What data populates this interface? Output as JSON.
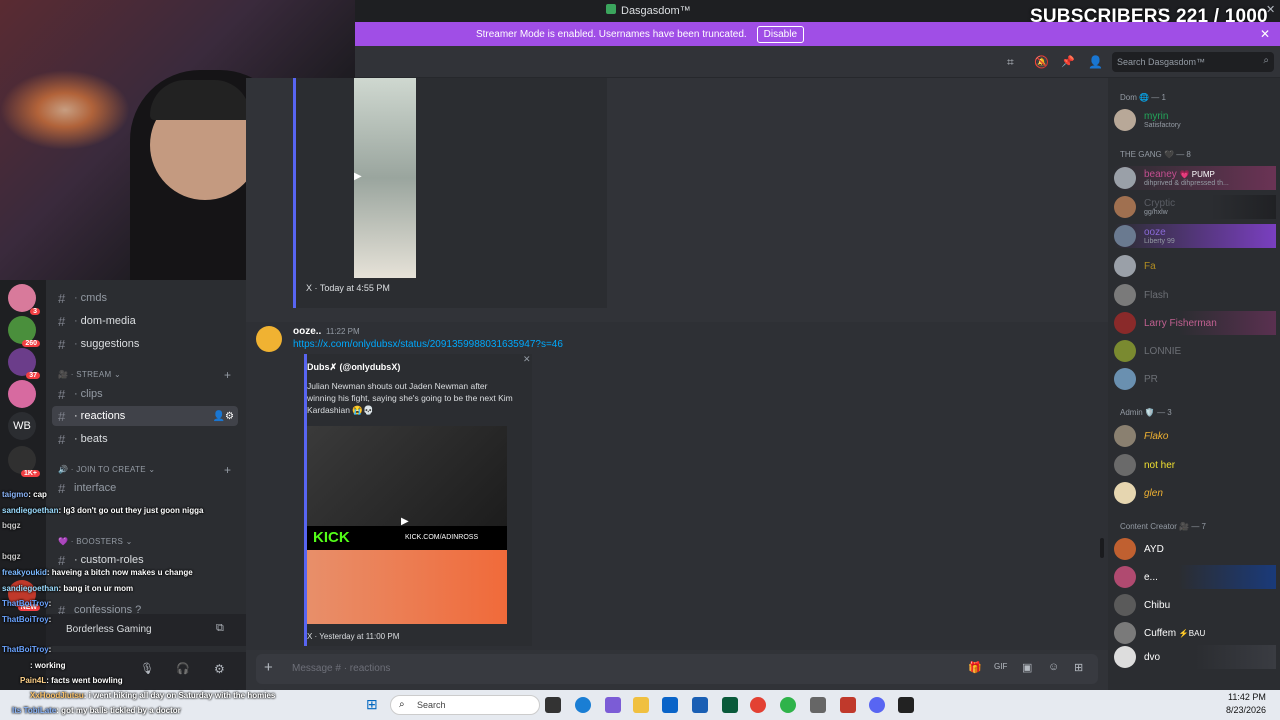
{
  "window": {
    "title": "Dasgasdom™"
  },
  "overlay": {
    "subscribers": "SUBSCRIBERS 221 / 1000"
  },
  "streamer_banner": {
    "text": "Streamer Mode is enabled. Usernames have been truncated.",
    "button": "Disable"
  },
  "header": {
    "search_placeholder": "Search Dasgasdom™"
  },
  "servers": {
    "badges": [
      "3",
      "260",
      "37",
      "WB",
      "1K+",
      "NEW"
    ]
  },
  "channels": {
    "items": [
      {
        "name": "cmds"
      },
      {
        "name": "dom-media"
      },
      {
        "name": "suggestions"
      }
    ],
    "category_stream": "STREAM",
    "stream_items": [
      {
        "name": "clips"
      },
      {
        "name": "reactions"
      },
      {
        "name": "beats"
      }
    ],
    "category_join": "JOIN TO CREATE",
    "join_item": "interface",
    "category_boosters": "BOOSTERS",
    "booster_item": "custom-roles",
    "confessions": "confessions ?",
    "voice_server": "Borderless Gaming"
  },
  "stream_chat": [
    {
      "user": "taigmo",
      "text": ": cap"
    },
    {
      "user": "sandiegoethan",
      "text": ": lg3 don't go out they just goon nigga"
    },
    {
      "user": "bqgz",
      "text": ""
    },
    {
      "user": "bqgz",
      "text": ""
    },
    {
      "user": "freakyoukid",
      "text": ": haveing a bitch now makes u change"
    },
    {
      "user": "sandiegoethan",
      "text": ": bang it on ur mom"
    },
    {
      "user": "ThatBoiTroy",
      "text": ":"
    },
    {
      "user": "ThatBoiTroy",
      "text": ":"
    },
    {
      "user": "ThatBoiTroy",
      "text": ":"
    },
    {
      "user": "",
      "text": ": working"
    },
    {
      "user": "Pain4L",
      "text": ": facts went bowling"
    },
    {
      "user": "XxHoodJiutsu",
      "text": ": i went hiking all day on Saturday with the homies"
    },
    {
      "user": "Its TobiLate",
      "text": ": got my balls tickled by a doctor"
    }
  ],
  "messages": [
    {
      "embed_footer": "X · Today at 4:55 PM"
    },
    {
      "author": "ooze..",
      "time": "11:22 PM",
      "link": "https://x.com/onlydubsx/status/2091359988031635947?s=46",
      "embed_author": "Dubs✗ (@onlydubsX)",
      "embed_text": "Julian Newman shouts out Jaden Newman after winning his fight, saying she's going to be the next Kim Kardashian 😭💀",
      "image_text": "KICK",
      "image_url_text": "KICK.COM/ADINROSS",
      "embed_footer": "X · Yesterday at 11:00 PM"
    }
  ],
  "composer": {
    "placeholder": "Message # · reactions"
  },
  "members": {
    "group_dom": "Dom 🌐 — 1",
    "dom": [
      {
        "name": "myrin",
        "status": "Satisfactory",
        "color": "#23a55a"
      }
    ],
    "group_gang": "THE GANG 🖤 — 8",
    "gang": [
      {
        "name": "beaney",
        "status": "dihprived & dihpressed th...",
        "tag": "💗 PUMP",
        "color": "#c24e8f"
      },
      {
        "name": "Cryptic",
        "status": "gg/hxlw",
        "color": "#5a5d64"
      },
      {
        "name": "ooze",
        "status": "Liberty 99",
        "color": "#8a6ad8"
      },
      {
        "name": "Fa",
        "status": "",
        "color": "#b18d22"
      },
      {
        "name": "Flash",
        "status": "",
        "color": "#6c6f75"
      },
      {
        "name": "Larry Fisherman",
        "status": "",
        "color": "#c06090"
      },
      {
        "name": "LONNIE",
        "status": "",
        "color": "#6c6f75"
      },
      {
        "name": "PR",
        "status": "",
        "color": "#6c6f75"
      }
    ],
    "group_admin": "Admin 🛡️ — 3",
    "admin": [
      {
        "name": "Flako",
        "color": "#f0b232"
      },
      {
        "name": "not her",
        "color": "#f0e030"
      },
      {
        "name": "glen",
        "color": "#f0b232"
      }
    ],
    "group_creator": "Content Creator 🎥 — 7",
    "creator": [
      {
        "name": "AYD",
        "tag": "",
        "color": "#dbdee1"
      },
      {
        "name": "e...",
        "tag": "",
        "color": "#dbdee1"
      },
      {
        "name": "Chibu",
        "tag": "",
        "color": "#dbdee1"
      },
      {
        "name": "Cuffem",
        "tag": "⚡BAU",
        "color": "#dbdee1"
      },
      {
        "name": "dvo",
        "tag": "",
        "color": "#dbdee1"
      }
    ]
  },
  "taskbar": {
    "search": "Search",
    "time": "11:42 PM",
    "date": "8/23/2026"
  }
}
